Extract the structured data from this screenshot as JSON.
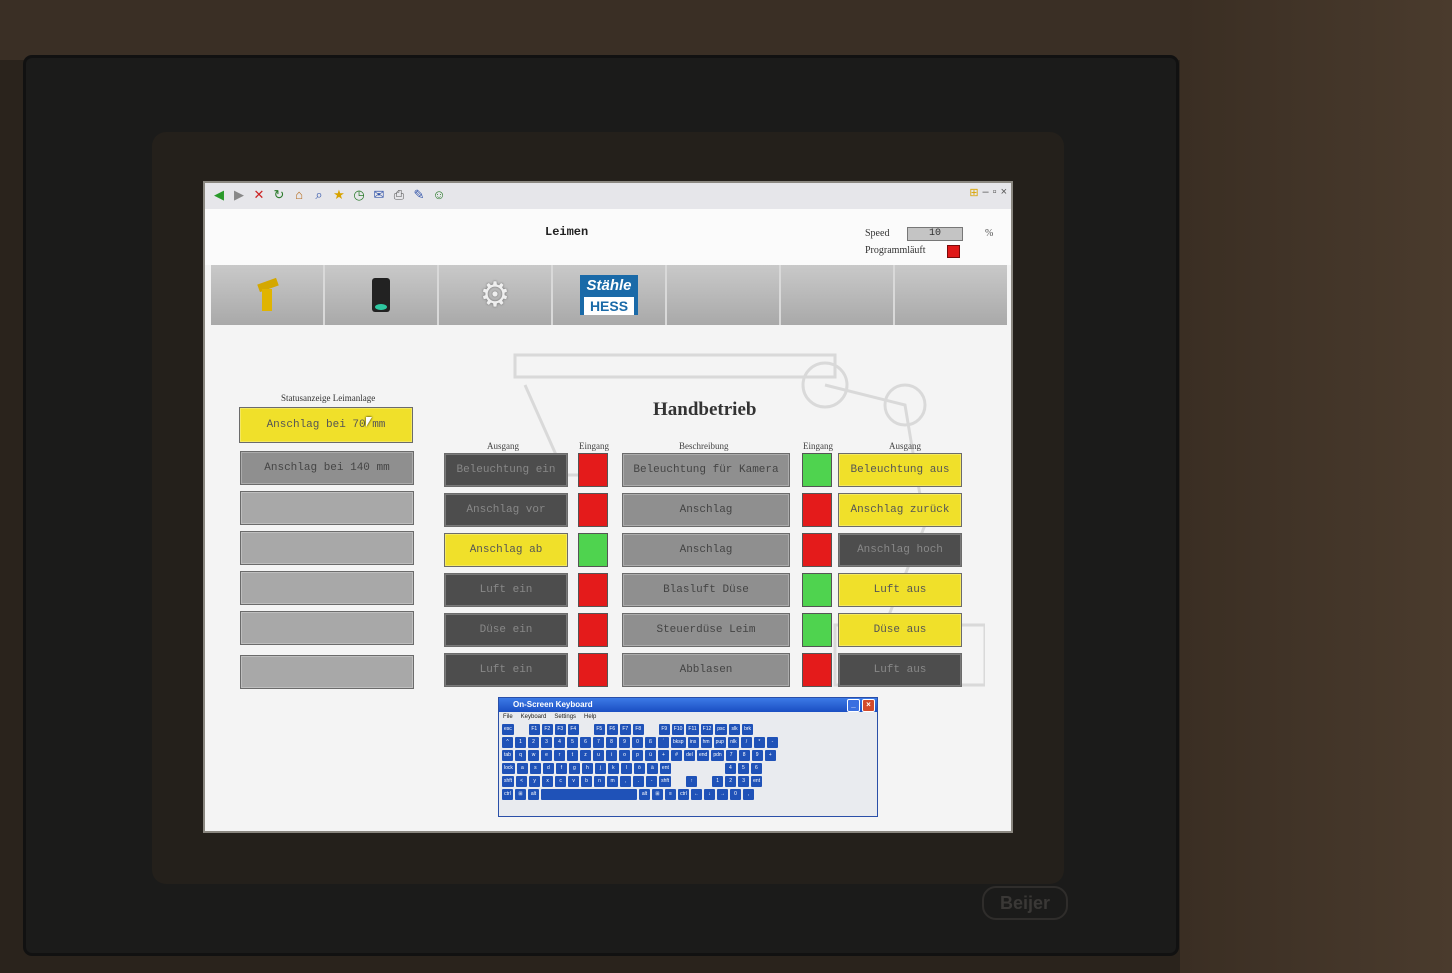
{
  "window": {
    "title": "Leimen"
  },
  "speed": {
    "label": "Speed",
    "value": "10",
    "unit": "%"
  },
  "program": {
    "label": "Programmläuft",
    "status_color": "#e01818"
  },
  "toolbar": {
    "buttons": [
      {
        "icon": "robot-icon"
      },
      {
        "icon": "camera-icon"
      },
      {
        "icon": "gear-icon"
      },
      {
        "icon": "stahle-hess-logo",
        "logo_line1": "Stähle",
        "logo_line2": "HESS"
      },
      {
        "icon": ""
      },
      {
        "icon": ""
      },
      {
        "icon": ""
      }
    ]
  },
  "status": {
    "title": "Statusanzeige Leimanlage",
    "items": [
      {
        "label": "Anschlag bei 70 mm",
        "state": "active"
      },
      {
        "label": "Anschlag bei 140 mm",
        "state": "inactive"
      },
      {
        "label": "",
        "state": "empty"
      },
      {
        "label": "",
        "state": "empty"
      },
      {
        "label": "",
        "state": "empty"
      },
      {
        "label": "",
        "state": "empty"
      },
      {
        "label": "",
        "state": "empty"
      }
    ]
  },
  "manual": {
    "title": "Handbetrieb",
    "headers": {
      "output_left": "Ausgang",
      "input_left": "Eingang",
      "description": "Beschreibung",
      "input_right": "Eingang",
      "output_right": "Ausgang"
    },
    "rows": [
      {
        "out_left": "Beleuchtung ein",
        "out_left_state": "off",
        "in_left": "red",
        "desc": "Beleuchtung für Kamera",
        "in_right": "green",
        "out_right": "Beleuchtung aus",
        "out_right_state": "on"
      },
      {
        "out_left": "Anschlag vor",
        "out_left_state": "off",
        "in_left": "red",
        "desc": "Anschlag",
        "in_right": "red",
        "out_right": "Anschlag zurück",
        "out_right_state": "on"
      },
      {
        "out_left": "Anschlag ab",
        "out_left_state": "on",
        "in_left": "green",
        "desc": "Anschlag",
        "in_right": "red",
        "out_right": "Anschlag hoch",
        "out_right_state": "off"
      },
      {
        "out_left": "Luft ein",
        "out_left_state": "off",
        "in_left": "red",
        "desc": "Blasluft Düse",
        "in_right": "green",
        "out_right": "Luft aus",
        "out_right_state": "on"
      },
      {
        "out_left": "Düse ein",
        "out_left_state": "off",
        "in_left": "red",
        "desc": "Steuerdüse Leim",
        "in_right": "green",
        "out_right": "Düse aus",
        "out_right_state": "on"
      },
      {
        "out_left": "Luft ein",
        "out_left_state": "off",
        "in_left": "red",
        "desc": "Abblasen",
        "in_right": "red",
        "out_right": "Luft aus",
        "out_right_state": "off"
      }
    ]
  },
  "osk": {
    "title": "On-Screen Keyboard",
    "menu": [
      "File",
      "Keyboard",
      "Settings",
      "Help"
    ],
    "rows": [
      [
        "esc",
        "",
        "F1",
        "F2",
        "F3",
        "F4",
        "",
        "F5",
        "F6",
        "F7",
        "F8",
        "",
        "F9",
        "F10",
        "F11",
        "F12",
        "psc",
        "slk",
        "brk"
      ],
      [
        "^",
        "1",
        "2",
        "3",
        "4",
        "5",
        "6",
        "7",
        "8",
        "9",
        "0",
        "ß",
        "´",
        "bksp",
        "ins",
        "hm",
        "pup",
        "nlk",
        "/",
        "*",
        "-"
      ],
      [
        "tab",
        "q",
        "w",
        "e",
        "r",
        "t",
        "z",
        "u",
        "i",
        "o",
        "p",
        "ü",
        "+",
        "#",
        "del",
        "end",
        "pdn",
        "7",
        "8",
        "9",
        "+"
      ],
      [
        "lock",
        "a",
        "s",
        "d",
        "f",
        "g",
        "h",
        "j",
        "k",
        "l",
        "ö",
        "ä",
        "ent",
        "",
        "",
        "",
        "",
        "4",
        "5",
        "6"
      ],
      [
        "shft",
        "<",
        "y",
        "x",
        "c",
        "v",
        "b",
        "n",
        "m",
        ",",
        ".",
        "-",
        "shft",
        "",
        "↑",
        "",
        "1",
        "2",
        "3",
        "ent"
      ],
      [
        "ctrl",
        "⊞",
        "alt",
        "",
        "alt",
        "⊞",
        "≡",
        "ctrl",
        "←",
        "↓",
        "→",
        "0",
        ","
      ]
    ]
  },
  "hardware": {
    "brand": "Beijer"
  }
}
